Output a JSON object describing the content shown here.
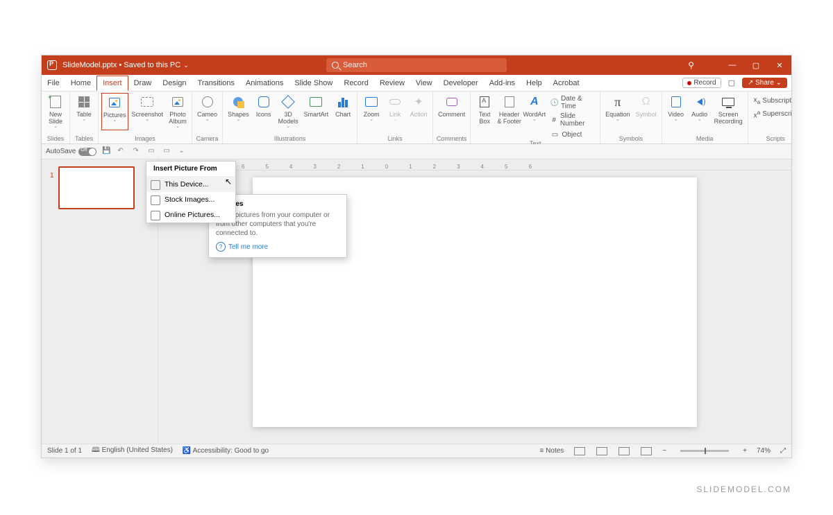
{
  "titlebar": {
    "filename": "SlideModel.pptx",
    "save_status": "Saved to this PC",
    "search_placeholder": "Search"
  },
  "window": {
    "minimize": "—",
    "maximize": "▢",
    "close": "✕"
  },
  "tabs": [
    "File",
    "Home",
    "Insert",
    "Draw",
    "Design",
    "Transitions",
    "Animations",
    "Slide Show",
    "Record",
    "Review",
    "View",
    "Developer",
    "Add-ins",
    "Help",
    "Acrobat"
  ],
  "active_tab": "Insert",
  "rightcontrols": {
    "record": "Record",
    "share": "Share"
  },
  "ribbon": {
    "groups": {
      "slides": {
        "label": "Slides",
        "new_slide": "New\nSlide"
      },
      "tables": {
        "label": "Tables",
        "table": "Table"
      },
      "images": {
        "label": "Images",
        "pictures": "Pictures",
        "screenshot": "Screenshot",
        "photo_album": "Photo\nAlbum"
      },
      "camera": {
        "label": "Camera",
        "cameo": "Cameo"
      },
      "illustrations": {
        "label": "Illustrations",
        "shapes": "Shapes",
        "icons": "Icons",
        "models": "3D\nModels",
        "smartart": "SmartArt",
        "chart": "Chart"
      },
      "links": {
        "label": "Links",
        "zoom": "Zoom",
        "link": "Link",
        "action": "Action"
      },
      "comments": {
        "label": "Comments",
        "comment": "Comment"
      },
      "text": {
        "label": "Text",
        "textbox": "Text\nBox",
        "header": "Header\n& Footer",
        "wordart": "WordArt",
        "datetime": "Date & Time",
        "slidenum": "Slide Number",
        "object": "Object"
      },
      "symbols": {
        "label": "Symbols",
        "equation": "Equation",
        "symbol": "Symbol"
      },
      "media": {
        "label": "Media",
        "video": "Video",
        "audio": "Audio",
        "screenrec": "Screen\nRecording"
      },
      "scripts": {
        "label": "Scripts",
        "subscript": "Subscript",
        "superscript": "Superscript"
      }
    }
  },
  "qat": {
    "autosave": "AutoSave",
    "off": "Off"
  },
  "dropdown": {
    "header": "Insert Picture From",
    "items": [
      "This Device...",
      "Stock Images...",
      "Online Pictures..."
    ]
  },
  "tooltip": {
    "title": "Pictures",
    "body": "Insert pictures from your computer or from other computers that you're connected to.",
    "link": "Tell me more"
  },
  "ruler": [
    "6",
    "5",
    "4",
    "3",
    "2",
    "1",
    "0",
    "1",
    "2",
    "3",
    "4",
    "5",
    "6"
  ],
  "thumb": {
    "number": "1"
  },
  "status": {
    "slide": "Slide 1 of 1",
    "lang": "English (United States)",
    "access": "Accessibility: Good to go",
    "notes": "Notes",
    "zoom": "74%"
  },
  "watermark": "SLIDEMODEL.COM"
}
